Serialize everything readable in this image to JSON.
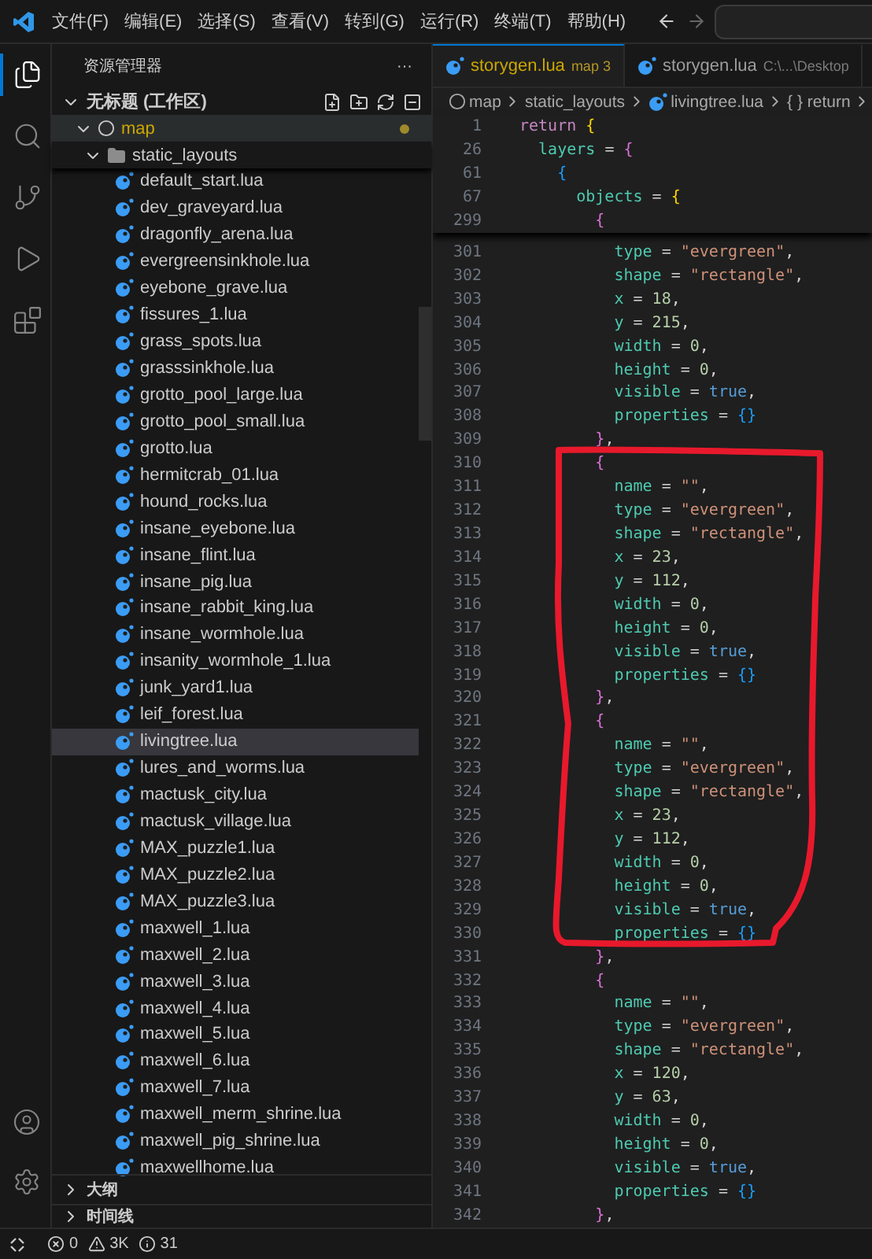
{
  "menu": [
    "文件(F)",
    "编辑(E)",
    "选择(S)",
    "查看(V)",
    "转到(G)",
    "运行(R)",
    "终端(T)",
    "帮助(H)"
  ],
  "activity": [
    {
      "kind": "explorer",
      "selected": true
    },
    {
      "kind": "search",
      "selected": false
    },
    {
      "kind": "source-control",
      "selected": false
    },
    {
      "kind": "run",
      "selected": false
    },
    {
      "kind": "extensions",
      "selected": false
    }
  ],
  "activity_bottom": [
    {
      "kind": "account"
    },
    {
      "kind": "settings"
    }
  ],
  "sidebar": {
    "title": "资源管理器",
    "more": "···",
    "workspace": {
      "label": "无标题 (工作区)",
      "expanded": true
    },
    "folder": {
      "label": "map",
      "modified": true,
      "expanded": true
    },
    "subfolder": {
      "label": "static_layouts",
      "expanded": true
    },
    "files": [
      {
        "name": "default_start.lua",
        "selected": false
      },
      {
        "name": "dev_graveyard.lua",
        "selected": false
      },
      {
        "name": "dragonfly_arena.lua",
        "selected": false
      },
      {
        "name": "evergreensinkhole.lua",
        "selected": false
      },
      {
        "name": "eyebone_grave.lua",
        "selected": false
      },
      {
        "name": "fissures_1.lua",
        "selected": false
      },
      {
        "name": "grass_spots.lua",
        "selected": false
      },
      {
        "name": "grasssinkhole.lua",
        "selected": false
      },
      {
        "name": "grotto_pool_large.lua",
        "selected": false
      },
      {
        "name": "grotto_pool_small.lua",
        "selected": false
      },
      {
        "name": "grotto.lua",
        "selected": false
      },
      {
        "name": "hermitcrab_01.lua",
        "selected": false
      },
      {
        "name": "hound_rocks.lua",
        "selected": false
      },
      {
        "name": "insane_eyebone.lua",
        "selected": false
      },
      {
        "name": "insane_flint.lua",
        "selected": false
      },
      {
        "name": "insane_pig.lua",
        "selected": false
      },
      {
        "name": "insane_rabbit_king.lua",
        "selected": false
      },
      {
        "name": "insane_wormhole.lua",
        "selected": false
      },
      {
        "name": "insanity_wormhole_1.lua",
        "selected": false
      },
      {
        "name": "junk_yard1.lua",
        "selected": false
      },
      {
        "name": "leif_forest.lua",
        "selected": false
      },
      {
        "name": "livingtree.lua",
        "selected": true
      },
      {
        "name": "lures_and_worms.lua",
        "selected": false
      },
      {
        "name": "mactusk_city.lua",
        "selected": false
      },
      {
        "name": "mactusk_village.lua",
        "selected": false
      },
      {
        "name": "MAX_puzzle1.lua",
        "selected": false
      },
      {
        "name": "MAX_puzzle2.lua",
        "selected": false
      },
      {
        "name": "MAX_puzzle3.lua",
        "selected": false
      },
      {
        "name": "maxwell_1.lua",
        "selected": false
      },
      {
        "name": "maxwell_2.lua",
        "selected": false
      },
      {
        "name": "maxwell_3.lua",
        "selected": false
      },
      {
        "name": "maxwell_4.lua",
        "selected": false
      },
      {
        "name": "maxwell_5.lua",
        "selected": false
      },
      {
        "name": "maxwell_6.lua",
        "selected": false
      },
      {
        "name": "maxwell_7.lua",
        "selected": false
      },
      {
        "name": "maxwell_merm_shrine.lua",
        "selected": false
      },
      {
        "name": "maxwell_pig_shrine.lua",
        "selected": false
      },
      {
        "name": "maxwellhome.lua",
        "selected": false
      }
    ],
    "panels": [
      {
        "label": "大纲",
        "expanded": false
      },
      {
        "label": "时间线",
        "expanded": false
      }
    ]
  },
  "tabs": [
    {
      "label": "storygen.lua",
      "detail": "map 3",
      "selected": true,
      "warning": true
    },
    {
      "label": "storygen.lua",
      "detail": "C:\\...\\Desktop",
      "selected": false,
      "warning": false
    }
  ],
  "breadcrumbs": [
    {
      "kind": "root",
      "text": "map"
    },
    {
      "kind": "folder",
      "text": "static_layouts"
    },
    {
      "kind": "file",
      "text": "livingtree.lua"
    },
    {
      "kind": "symbol",
      "text": "{ } return"
    }
  ],
  "sticky_lines": [
    {
      "number": "1",
      "tokens": [
        {
          "kind": "keyword",
          "text": "return"
        },
        {
          "kind": "brace1",
          "text": " {"
        }
      ]
    },
    {
      "number": "26",
      "tokens": [
        {
          "kind": "key",
          "text": "  layers"
        },
        {
          "kind": "op",
          "text": " = "
        },
        {
          "kind": "brace2",
          "text": "{"
        }
      ]
    },
    {
      "number": "61",
      "tokens": [
        {
          "kind": "brace3",
          "text": "    {"
        }
      ]
    },
    {
      "number": "67",
      "tokens": [
        {
          "kind": "key",
          "text": "      objects"
        },
        {
          "kind": "op",
          "text": " = "
        },
        {
          "kind": "brace1",
          "text": "{"
        }
      ]
    },
    {
      "number": "299",
      "tokens": [
        {
          "kind": "brace2",
          "text": "        {"
        }
      ]
    }
  ],
  "lines": [
    {
      "number": "301",
      "tokens": [
        {
          "kind": "key",
          "text": "          type"
        },
        {
          "kind": "op",
          "text": " = "
        },
        {
          "kind": "string",
          "text": "\"evergreen\""
        },
        {
          "kind": "op",
          "text": ","
        }
      ]
    },
    {
      "number": "302",
      "tokens": [
        {
          "kind": "key",
          "text": "          shape"
        },
        {
          "kind": "op",
          "text": " = "
        },
        {
          "kind": "string",
          "text": "\"rectangle\""
        },
        {
          "kind": "op",
          "text": ","
        }
      ]
    },
    {
      "number": "303",
      "tokens": [
        {
          "kind": "key",
          "text": "          x"
        },
        {
          "kind": "op",
          "text": " = "
        },
        {
          "kind": "number",
          "text": "18"
        },
        {
          "kind": "op",
          "text": ","
        }
      ]
    },
    {
      "number": "304",
      "tokens": [
        {
          "kind": "key",
          "text": "          y"
        },
        {
          "kind": "op",
          "text": " = "
        },
        {
          "kind": "number",
          "text": "215"
        },
        {
          "kind": "op",
          "text": ","
        }
      ]
    },
    {
      "number": "305",
      "tokens": [
        {
          "kind": "key",
          "text": "          width"
        },
        {
          "kind": "op",
          "text": " = "
        },
        {
          "kind": "number",
          "text": "0"
        },
        {
          "kind": "op",
          "text": ","
        }
      ]
    },
    {
      "number": "306",
      "tokens": [
        {
          "kind": "key",
          "text": "          height"
        },
        {
          "kind": "op",
          "text": " = "
        },
        {
          "kind": "number",
          "text": "0"
        },
        {
          "kind": "op",
          "text": ","
        }
      ]
    },
    {
      "number": "307",
      "tokens": [
        {
          "kind": "key",
          "text": "          visible"
        },
        {
          "kind": "op",
          "text": " = "
        },
        {
          "kind": "bool",
          "text": "true"
        },
        {
          "kind": "op",
          "text": ","
        }
      ]
    },
    {
      "number": "308",
      "tokens": [
        {
          "kind": "key",
          "text": "          properties"
        },
        {
          "kind": "op",
          "text": " = "
        },
        {
          "kind": "brace3",
          "text": "{}"
        }
      ]
    },
    {
      "number": "309",
      "tokens": [
        {
          "kind": "brace2",
          "text": "        }"
        },
        {
          "kind": "op",
          "text": ","
        }
      ]
    },
    {
      "number": "310",
      "tokens": [
        {
          "kind": "brace2",
          "text": "        {"
        }
      ]
    },
    {
      "number": "311",
      "tokens": [
        {
          "kind": "key",
          "text": "          name"
        },
        {
          "kind": "op",
          "text": " = "
        },
        {
          "kind": "string",
          "text": "\"\""
        },
        {
          "kind": "op",
          "text": ","
        }
      ]
    },
    {
      "number": "312",
      "tokens": [
        {
          "kind": "key",
          "text": "          type"
        },
        {
          "kind": "op",
          "text": " = "
        },
        {
          "kind": "string",
          "text": "\"evergreen\""
        },
        {
          "kind": "op",
          "text": ","
        }
      ]
    },
    {
      "number": "313",
      "tokens": [
        {
          "kind": "key",
          "text": "          shape"
        },
        {
          "kind": "op",
          "text": " = "
        },
        {
          "kind": "string",
          "text": "\"rectangle\""
        },
        {
          "kind": "op",
          "text": ","
        }
      ]
    },
    {
      "number": "314",
      "tokens": [
        {
          "kind": "key",
          "text": "          x"
        },
        {
          "kind": "op",
          "text": " = "
        },
        {
          "kind": "number",
          "text": "23"
        },
        {
          "kind": "op",
          "text": ","
        }
      ]
    },
    {
      "number": "315",
      "tokens": [
        {
          "kind": "key",
          "text": "          y"
        },
        {
          "kind": "op",
          "text": " = "
        },
        {
          "kind": "number",
          "text": "112"
        },
        {
          "kind": "op",
          "text": ","
        }
      ]
    },
    {
      "number": "316",
      "tokens": [
        {
          "kind": "key",
          "text": "          width"
        },
        {
          "kind": "op",
          "text": " = "
        },
        {
          "kind": "number",
          "text": "0"
        },
        {
          "kind": "op",
          "text": ","
        }
      ]
    },
    {
      "number": "317",
      "tokens": [
        {
          "kind": "key",
          "text": "          height"
        },
        {
          "kind": "op",
          "text": " = "
        },
        {
          "kind": "number",
          "text": "0"
        },
        {
          "kind": "op",
          "text": ","
        }
      ]
    },
    {
      "number": "318",
      "tokens": [
        {
          "kind": "key",
          "text": "          visible"
        },
        {
          "kind": "op",
          "text": " = "
        },
        {
          "kind": "bool",
          "text": "true"
        },
        {
          "kind": "op",
          "text": ","
        }
      ]
    },
    {
      "number": "319",
      "tokens": [
        {
          "kind": "key",
          "text": "          properties"
        },
        {
          "kind": "op",
          "text": " = "
        },
        {
          "kind": "brace3",
          "text": "{}"
        }
      ]
    },
    {
      "number": "320",
      "tokens": [
        {
          "kind": "brace2",
          "text": "        }"
        },
        {
          "kind": "op",
          "text": ","
        }
      ]
    },
    {
      "number": "321",
      "tokens": [
        {
          "kind": "brace2",
          "text": "        {"
        }
      ]
    },
    {
      "number": "322",
      "tokens": [
        {
          "kind": "key",
          "text": "          name"
        },
        {
          "kind": "op",
          "text": " = "
        },
        {
          "kind": "string",
          "text": "\"\""
        },
        {
          "kind": "op",
          "text": ","
        }
      ]
    },
    {
      "number": "323",
      "tokens": [
        {
          "kind": "key",
          "text": "          type"
        },
        {
          "kind": "op",
          "text": " = "
        },
        {
          "kind": "string",
          "text": "\"evergreen\""
        },
        {
          "kind": "op",
          "text": ","
        }
      ]
    },
    {
      "number": "324",
      "tokens": [
        {
          "kind": "key",
          "text": "          shape"
        },
        {
          "kind": "op",
          "text": " = "
        },
        {
          "kind": "string",
          "text": "\"rectangle\""
        },
        {
          "kind": "op",
          "text": ","
        }
      ]
    },
    {
      "number": "325",
      "tokens": [
        {
          "kind": "key",
          "text": "          x"
        },
        {
          "kind": "op",
          "text": " = "
        },
        {
          "kind": "number",
          "text": "23"
        },
        {
          "kind": "op",
          "text": ","
        }
      ]
    },
    {
      "number": "326",
      "tokens": [
        {
          "kind": "key",
          "text": "          y"
        },
        {
          "kind": "op",
          "text": " = "
        },
        {
          "kind": "number",
          "text": "112"
        },
        {
          "kind": "op",
          "text": ","
        }
      ]
    },
    {
      "number": "327",
      "tokens": [
        {
          "kind": "key",
          "text": "          width"
        },
        {
          "kind": "op",
          "text": " = "
        },
        {
          "kind": "number",
          "text": "0"
        },
        {
          "kind": "op",
          "text": ","
        }
      ]
    },
    {
      "number": "328",
      "tokens": [
        {
          "kind": "key",
          "text": "          height"
        },
        {
          "kind": "op",
          "text": " = "
        },
        {
          "kind": "number",
          "text": "0"
        },
        {
          "kind": "op",
          "text": ","
        }
      ]
    },
    {
      "number": "329",
      "tokens": [
        {
          "kind": "key",
          "text": "          visible"
        },
        {
          "kind": "op",
          "text": " = "
        },
        {
          "kind": "bool",
          "text": "true"
        },
        {
          "kind": "op",
          "text": ","
        }
      ]
    },
    {
      "number": "330",
      "tokens": [
        {
          "kind": "key",
          "text": "          properties"
        },
        {
          "kind": "op",
          "text": " = "
        },
        {
          "kind": "brace3",
          "text": "{}"
        }
      ]
    },
    {
      "number": "331",
      "tokens": [
        {
          "kind": "brace2",
          "text": "        }"
        },
        {
          "kind": "op",
          "text": ","
        }
      ]
    },
    {
      "number": "332",
      "tokens": [
        {
          "kind": "brace2",
          "text": "        {"
        }
      ]
    },
    {
      "number": "333",
      "tokens": [
        {
          "kind": "key",
          "text": "          name"
        },
        {
          "kind": "op",
          "text": " = "
        },
        {
          "kind": "string",
          "text": "\"\""
        },
        {
          "kind": "op",
          "text": ","
        }
      ]
    },
    {
      "number": "334",
      "tokens": [
        {
          "kind": "key",
          "text": "          type"
        },
        {
          "kind": "op",
          "text": " = "
        },
        {
          "kind": "string",
          "text": "\"evergreen\""
        },
        {
          "kind": "op",
          "text": ","
        }
      ]
    },
    {
      "number": "335",
      "tokens": [
        {
          "kind": "key",
          "text": "          shape"
        },
        {
          "kind": "op",
          "text": " = "
        },
        {
          "kind": "string",
          "text": "\"rectangle\""
        },
        {
          "kind": "op",
          "text": ","
        }
      ]
    },
    {
      "number": "336",
      "tokens": [
        {
          "kind": "key",
          "text": "          x"
        },
        {
          "kind": "op",
          "text": " = "
        },
        {
          "kind": "number",
          "text": "120"
        },
        {
          "kind": "op",
          "text": ","
        }
      ]
    },
    {
      "number": "337",
      "tokens": [
        {
          "kind": "key",
          "text": "          y"
        },
        {
          "kind": "op",
          "text": " = "
        },
        {
          "kind": "number",
          "text": "63"
        },
        {
          "kind": "op",
          "text": ","
        }
      ]
    },
    {
      "number": "338",
      "tokens": [
        {
          "kind": "key",
          "text": "          width"
        },
        {
          "kind": "op",
          "text": " = "
        },
        {
          "kind": "number",
          "text": "0"
        },
        {
          "kind": "op",
          "text": ","
        }
      ]
    },
    {
      "number": "339",
      "tokens": [
        {
          "kind": "key",
          "text": "          height"
        },
        {
          "kind": "op",
          "text": " = "
        },
        {
          "kind": "number",
          "text": "0"
        },
        {
          "kind": "op",
          "text": ","
        }
      ]
    },
    {
      "number": "340",
      "tokens": [
        {
          "kind": "key",
          "text": "          visible"
        },
        {
          "kind": "op",
          "text": " = "
        },
        {
          "kind": "bool",
          "text": "true"
        },
        {
          "kind": "op",
          "text": ","
        }
      ]
    },
    {
      "number": "341",
      "tokens": [
        {
          "kind": "key",
          "text": "          properties"
        },
        {
          "kind": "op",
          "text": " = "
        },
        {
          "kind": "brace3",
          "text": "{}"
        }
      ]
    },
    {
      "number": "342",
      "tokens": [
        {
          "kind": "brace2",
          "text": "        }"
        },
        {
          "kind": "op",
          "text": ","
        }
      ]
    }
  ],
  "status": [
    {
      "kind": "error",
      "text": "0"
    },
    {
      "kind": "warning",
      "text": "3K"
    },
    {
      "kind": "info",
      "text": "31"
    }
  ]
}
